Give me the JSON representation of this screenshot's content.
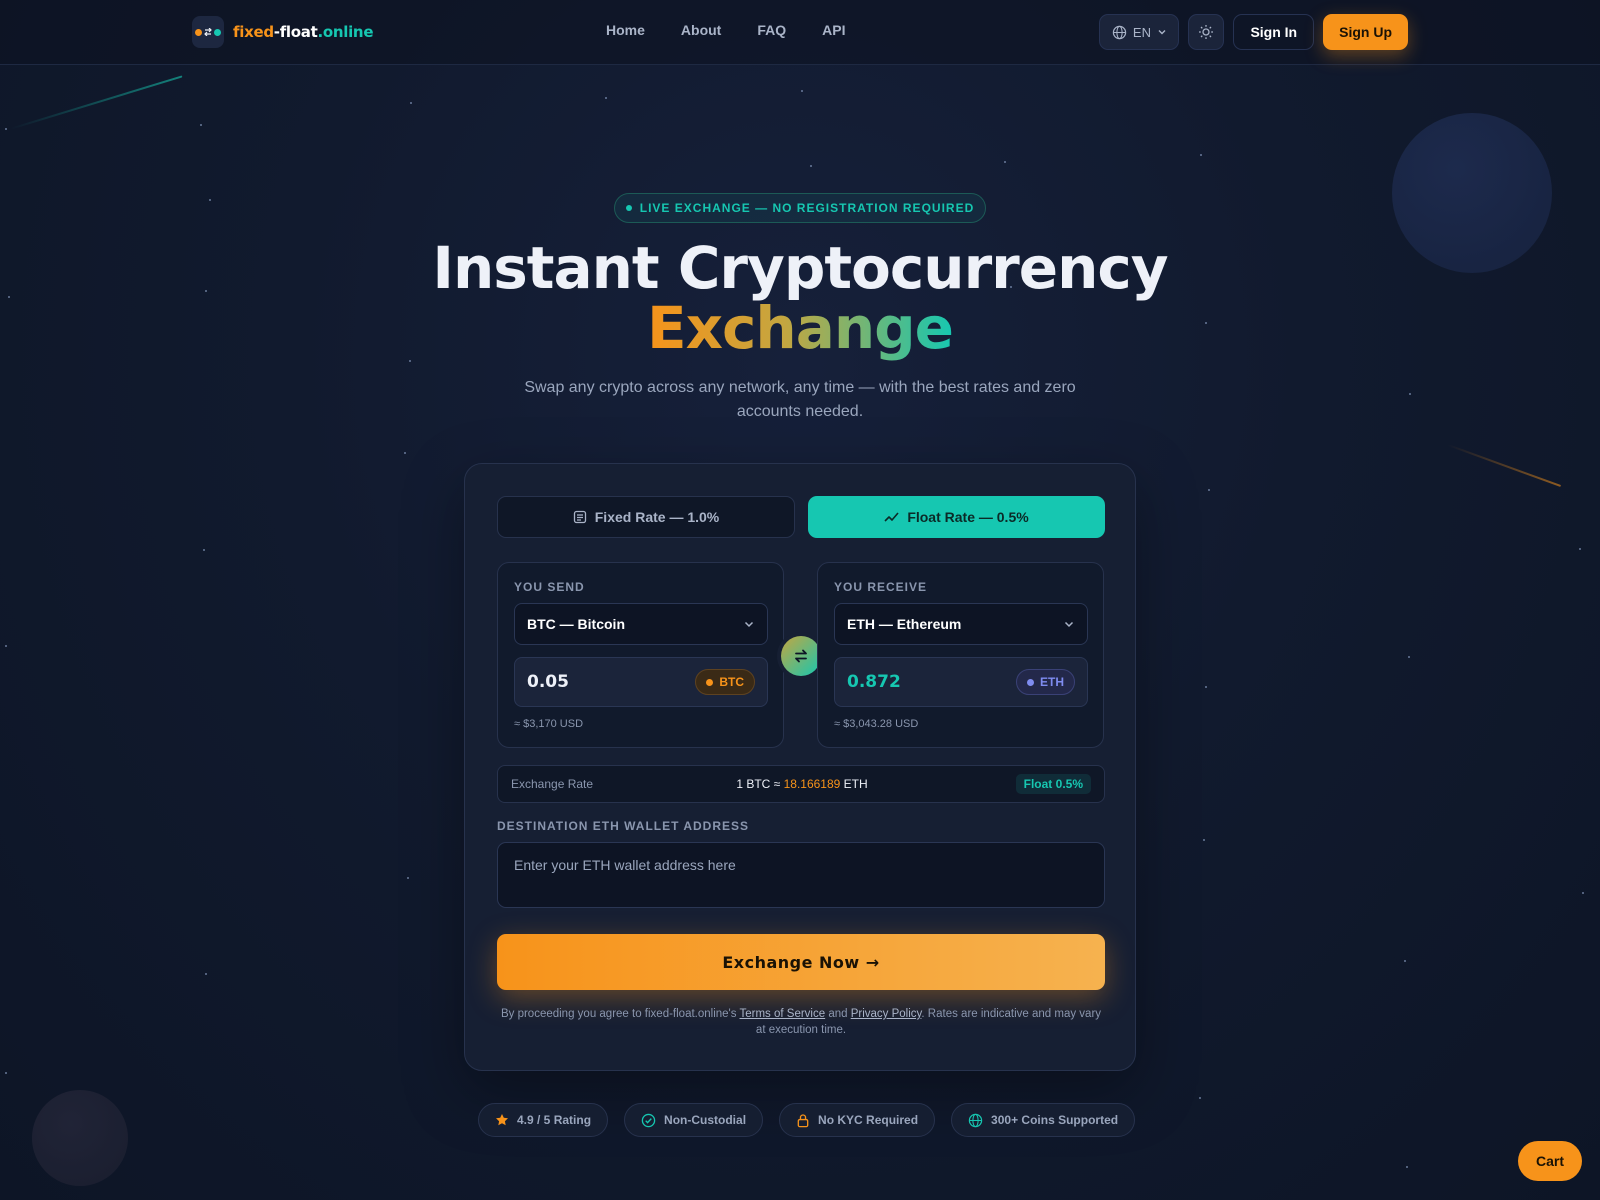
{
  "brand": {
    "part1": "fixed",
    "part2": "-float",
    "part3": ".online"
  },
  "nav": {
    "items": [
      "Home",
      "About",
      "FAQ",
      "API"
    ]
  },
  "header": {
    "language": "EN",
    "sign_in": "Sign In",
    "sign_up": "Sign Up"
  },
  "hero": {
    "badge": "LIVE EXCHANGE — NO REGISTRATION REQUIRED",
    "title_line1": "Instant Cryptocurrency",
    "title_line2": "Exchange",
    "subtitle": "Swap any crypto across any network, any time — with the best rates and zero accounts needed."
  },
  "exchange": {
    "tabs": {
      "fixed": "Fixed Rate — 1.0%",
      "float": "Float Rate — 0.5%",
      "active": "float"
    },
    "send": {
      "label": "YOU SEND",
      "coin": "BTC — Bitcoin",
      "amount": "0.05",
      "ticker": "BTC",
      "usd": "≈ $3,170 USD"
    },
    "receive": {
      "label": "YOU RECEIVE",
      "coin": "ETH — Ethereum",
      "amount": "0.872",
      "ticker": "ETH",
      "usd": "≈ $3,043.28 USD"
    },
    "rate": {
      "label": "Exchange Rate",
      "prefix": "1 BTC ≈ ",
      "value": "18.166189",
      "suffix": " ETH",
      "tag": "Float 0.5%"
    },
    "destination": {
      "label": "DESTINATION ETH WALLET ADDRESS",
      "placeholder": "Enter your ETH wallet address here",
      "value": ""
    },
    "submit": "Exchange Now →",
    "legal": {
      "before": "By proceeding you agree to fixed-float.online's ",
      "terms": "Terms of Service",
      "and": " and ",
      "privacy": "Privacy Policy",
      "after": ". Rates are indicative and may vary at execution time."
    }
  },
  "trust": {
    "items": [
      {
        "icon": "star-icon",
        "label": "4.9 / 5 Rating"
      },
      {
        "icon": "check-circle-icon",
        "label": "Non-Custodial"
      },
      {
        "icon": "lock-icon",
        "label": "No KYC Required"
      },
      {
        "icon": "globe-icon",
        "label": "300+ Coins Supported"
      }
    ]
  },
  "cart": {
    "label": "Cart"
  },
  "colors": {
    "accent_orange": "#f7931a",
    "accent_teal": "#16c7b1",
    "eth_blue": "#7f8cf0",
    "background": "#111a2e"
  }
}
